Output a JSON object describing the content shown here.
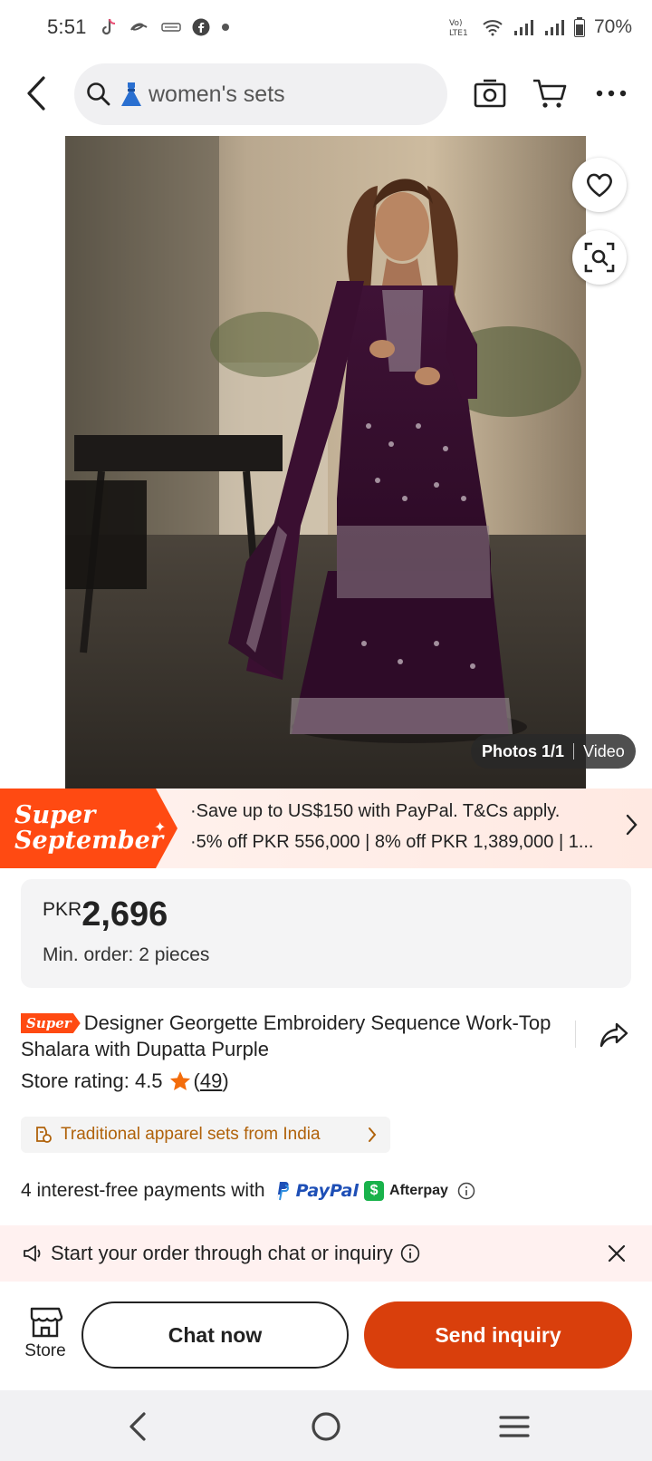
{
  "status_bar": {
    "time": "5:51",
    "battery": "70%",
    "app_icons": [
      "tiktok-icon",
      "alibaba-icon",
      "temu-icon",
      "facebook-icon",
      "dot-icon"
    ],
    "system_icons": [
      "volte-icon",
      "wifi-icon",
      "signal-icon",
      "signal-icon",
      "battery-icon"
    ]
  },
  "header": {
    "search_text": "women's sets",
    "icons": [
      "back-icon",
      "search-icon",
      "dress-icon",
      "camera-icon",
      "cart-icon",
      "more-icon"
    ]
  },
  "gallery": {
    "photos_label": "Photos 1/1",
    "video_label": "Video",
    "icons": [
      "heart-icon",
      "image-search-icon"
    ]
  },
  "promo": {
    "badge_line1": "Super",
    "badge_line2": "September",
    "line1": "·Save up to US$150 with PayPal. T&Cs apply.",
    "line2": "·5% off PKR 556,000 | 8% off PKR 1,389,000 | 1..."
  },
  "price": {
    "currency": "PKR",
    "value": "2,696",
    "min_order": "Min. order: 2 pieces"
  },
  "product": {
    "super_tag": "Super",
    "title": "Designer Georgette Embroidery Sequence Work-Top Shalara with Dupatta Purple",
    "rating_label": "Store rating: 4.5",
    "rating_count_open": "(",
    "rating_count": "49",
    "rating_count_close": ")",
    "category_chip": "Traditional apparel sets from India"
  },
  "payment": {
    "text": "4 interest-free payments with",
    "paypal": "PayPal",
    "afterpay": "Afterpay"
  },
  "notice": {
    "text": "Start your order through chat or inquiry"
  },
  "actions": {
    "store": "Store",
    "chat": "Chat now",
    "inquiry": "Send inquiry"
  },
  "colors": {
    "accent": "#d93f0c",
    "super_orange": "#ff4a12",
    "chip_text": "#b0620a",
    "notice_bg": "#fff1f0"
  }
}
